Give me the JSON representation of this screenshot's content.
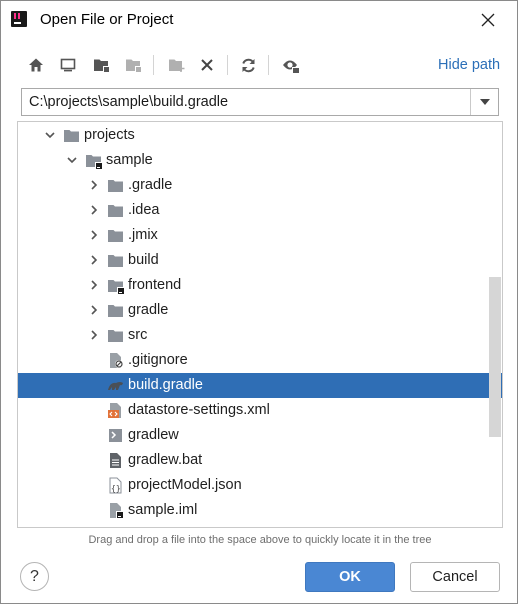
{
  "window": {
    "title": "Open File or Project"
  },
  "toolbar": {
    "buttons": [
      {
        "name": "home-icon"
      },
      {
        "name": "desktop-icon"
      },
      {
        "name": "project-folder-icon"
      },
      {
        "name": "module-folder-icon"
      },
      {
        "name": "new-folder-icon"
      },
      {
        "name": "delete-icon"
      },
      {
        "name": "refresh-icon"
      },
      {
        "name": "show-hidden-icon"
      }
    ],
    "hide_path_label": "Hide path"
  },
  "path": {
    "value": "C:\\projects\\sample\\build.gradle"
  },
  "tree": {
    "items": [
      {
        "label": "projects",
        "depth": 1,
        "expanded": true,
        "icon": "folder-icon"
      },
      {
        "label": "sample",
        "depth": 2,
        "expanded": true,
        "icon": "project-folder-icon"
      },
      {
        "label": ".gradle",
        "depth": 3,
        "expanded": false,
        "icon": "folder-icon"
      },
      {
        "label": ".idea",
        "depth": 3,
        "expanded": false,
        "icon": "folder-icon"
      },
      {
        "label": ".jmix",
        "depth": 3,
        "expanded": false,
        "icon": "folder-icon"
      },
      {
        "label": "build",
        "depth": 3,
        "expanded": false,
        "icon": "folder-icon"
      },
      {
        "label": "frontend",
        "depth": 3,
        "expanded": false,
        "icon": "project-folder-icon"
      },
      {
        "label": "gradle",
        "depth": 3,
        "expanded": false,
        "icon": "folder-icon"
      },
      {
        "label": "src",
        "depth": 3,
        "expanded": false,
        "icon": "folder-icon"
      },
      {
        "label": ".gitignore",
        "depth": 3,
        "icon": "ignore-file-icon"
      },
      {
        "label": "build.gradle",
        "depth": 3,
        "icon": "gradle-file-icon",
        "selected": true
      },
      {
        "label": "datastore-settings.xml",
        "depth": 3,
        "icon": "xml-file-icon"
      },
      {
        "label": "gradlew",
        "depth": 3,
        "icon": "shell-file-icon"
      },
      {
        "label": "gradlew.bat",
        "depth": 3,
        "icon": "text-file-icon"
      },
      {
        "label": "projectModel.json",
        "depth": 3,
        "icon": "json-file-icon"
      },
      {
        "label": "sample.iml",
        "depth": 3,
        "icon": "iml-file-icon"
      }
    ]
  },
  "hint": "Drag and drop a file into the space above to quickly locate it in the tree",
  "buttons": {
    "help": "?",
    "ok": "OK",
    "cancel": "Cancel"
  },
  "colors": {
    "accent": "#2f6eb5",
    "link": "#2b6fb8",
    "folder": "#8b9199",
    "ok": "#4a87d3"
  }
}
